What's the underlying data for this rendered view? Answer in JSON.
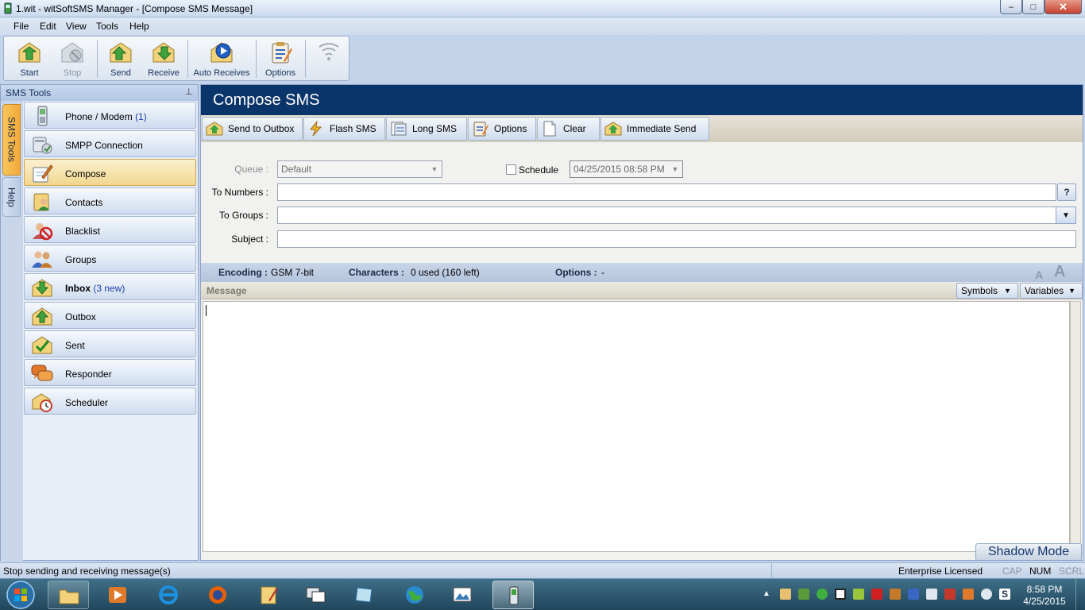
{
  "window": {
    "title": "1.wit - witSoftSMS Manager - [Compose SMS Message]",
    "minimize_glyph": "–",
    "maximize_glyph": "□",
    "close_glyph": "✕"
  },
  "menu": [
    "File",
    "Edit",
    "View",
    "Tools",
    "Help"
  ],
  "toolbar": {
    "start": "Start",
    "stop": "Stop",
    "send": "Send",
    "receive": "Receive",
    "auto_receives": "Auto Receives",
    "options": "Options"
  },
  "sidebar": {
    "title": "SMS Tools",
    "pin_glyph": "⊥",
    "side_tabs": [
      "SMS Tools",
      "Help"
    ],
    "items": [
      {
        "label": "Phone / Modem",
        "count": "(1)"
      },
      {
        "label": "SMPP Connection",
        "count": ""
      },
      {
        "label": "Compose",
        "count": ""
      },
      {
        "label": "Contacts",
        "count": ""
      },
      {
        "label": "Blacklist",
        "count": ""
      },
      {
        "label": "Groups",
        "count": ""
      },
      {
        "label": "Inbox",
        "count": "(3 new)"
      },
      {
        "label": "Outbox",
        "count": ""
      },
      {
        "label": "Sent",
        "count": ""
      },
      {
        "label": "Responder",
        "count": ""
      },
      {
        "label": "Scheduler",
        "count": ""
      }
    ]
  },
  "compose": {
    "header": "Compose SMS",
    "actions": [
      "Send to Outbox",
      "Flash SMS",
      "Long SMS",
      "Options",
      "Clear",
      "Immediate Send"
    ],
    "queue_label": "Queue :",
    "queue_value": "Default",
    "schedule_label": "Schedule",
    "schedule_value": "04/25/2015 08:58 PM",
    "to_numbers_label": "To Numbers :",
    "to_numbers_help": "?",
    "to_groups_label": "To Groups :",
    "subject_label": "Subject :",
    "encoding_label": "Encoding :",
    "encoding_value": "GSM 7-bit",
    "characters_label": "Characters :",
    "characters_value": "0 used (160 left)",
    "options_label": "Options :",
    "options_value": "-",
    "font_small": "A",
    "font_large": "A",
    "message_label": "Message",
    "symbols": "Symbols",
    "variables": "Variables",
    "shadow_mode": "Shadow Mode"
  },
  "status": {
    "message": "Stop sending and receiving message(s)",
    "license": "Enterprise Licensed",
    "cap": "CAP",
    "num": "NUM",
    "scrl": "SCRL"
  },
  "taskbar": {
    "time": "8:58 PM",
    "date": "4/25/2015",
    "tray_up": "▲"
  }
}
